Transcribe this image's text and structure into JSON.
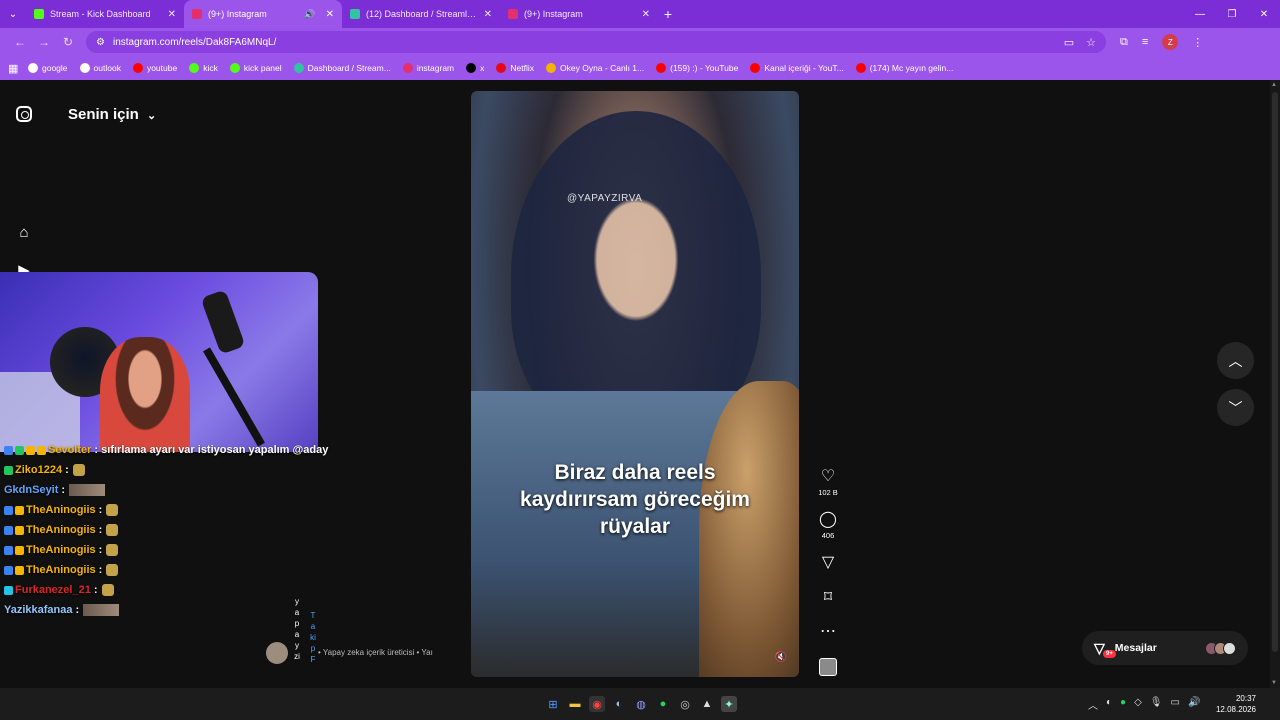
{
  "browser": {
    "tabs": [
      {
        "title": "Stream - Kick Dashboard",
        "color": "#53fc18",
        "active": false,
        "muted": false
      },
      {
        "title": "(9+) Instagram",
        "color": "#e1306c",
        "active": true,
        "muted": true
      },
      {
        "title": "(12) Dashboard / Streamlabs",
        "color": "#31c3a2",
        "active": false,
        "muted": false
      },
      {
        "title": "(9+) Instagram",
        "color": "#e1306c",
        "active": false,
        "muted": false
      }
    ],
    "url": "instagram.com/reels/Dak8FA6MNqL/",
    "profile_initial": "Z",
    "bookmarks": [
      {
        "label": "google",
        "color": "#ffffff"
      },
      {
        "label": "outlook",
        "color": "#ffffff"
      },
      {
        "label": "youtube",
        "color": "#ff0000"
      },
      {
        "label": "kick",
        "color": "#53fc18"
      },
      {
        "label": "kick panel",
        "color": "#53fc18"
      },
      {
        "label": "Dashboard / Stream...",
        "color": "#31c3a2"
      },
      {
        "label": "instagram",
        "color": "#e1306c"
      },
      {
        "label": "x",
        "color": "#000000"
      },
      {
        "label": "Netflix",
        "color": "#e50914"
      },
      {
        "label": "Okey Oyna - Canlı 1...",
        "color": "#f5b400"
      },
      {
        "label": "(159) :) - YouTube",
        "color": "#ff0000"
      },
      {
        "label": "Kanal içeriği - YouT...",
        "color": "#ff0000"
      },
      {
        "label": "(174) Mc yayın gelin...",
        "color": "#ff0000"
      }
    ]
  },
  "instagram": {
    "feed_title": "Senin için",
    "notifications_badge": "9+",
    "reel": {
      "watermark": "@YAPAYZIRVA",
      "caption_line1": "Biraz daha reels",
      "caption_line2": "kaydırırsam göreceğim",
      "caption_line3": "rüyalar"
    },
    "actions": {
      "likes": "102 B",
      "comments": "406"
    },
    "creator": {
      "username_vertical": "yapayzi",
      "follow_vertical": "Takip F",
      "subtitle": "• Yapay zeka içerik üreticisi • Yaı"
    },
    "messages": {
      "label": "Mesajlar",
      "badge": "9+"
    }
  },
  "stream_chat": [
    {
      "user": "Sevolter",
      "user_color": "#f5b400",
      "message": ": sıfırlama ayarı var istiyosan yapalım @aday",
      "badges": [
        "#3b82f6",
        "#22c55e",
        "#f5b400",
        "#f5b400"
      ]
    },
    {
      "user": "Ziko1224",
      "user_color": "#f5b400",
      "message": ":",
      "badges": [
        "#22c55e"
      ],
      "attachment": "emote"
    },
    {
      "user": "GkdnSeyit",
      "user_color": "#60a5fa",
      "message": ":",
      "badges": [],
      "attachment": "image"
    },
    {
      "user": "TheAninogiis",
      "user_color": "#f5b400",
      "message": ":",
      "badges": [
        "#3b82f6",
        "#f5b400"
      ],
      "attachment": "emote"
    },
    {
      "user": "TheAninogiis",
      "user_color": "#f5b400",
      "message": ":",
      "badges": [
        "#3b82f6",
        "#f5b400"
      ],
      "attachment": "emote"
    },
    {
      "user": "TheAninogiis",
      "user_color": "#f5b400",
      "message": ":",
      "badges": [
        "#3b82f6",
        "#f5b400"
      ],
      "attachment": "emote"
    },
    {
      "user": "TheAninogiis",
      "user_color": "#f5b400",
      "message": ":",
      "badges": [
        "#3b82f6",
        "#f5b400"
      ],
      "attachment": "emote"
    },
    {
      "user": "Furkanezel_21",
      "user_color": "#dc2626",
      "message": ":",
      "badges": [
        "#22c5e5"
      ],
      "attachment": "emote"
    },
    {
      "user": "Yazikkafanaa",
      "user_color": "#93c5fd",
      "message": ":",
      "badges": [],
      "attachment": "image"
    }
  ],
  "taskbar": {
    "time": "20:37",
    "date": "12.08.2026"
  }
}
